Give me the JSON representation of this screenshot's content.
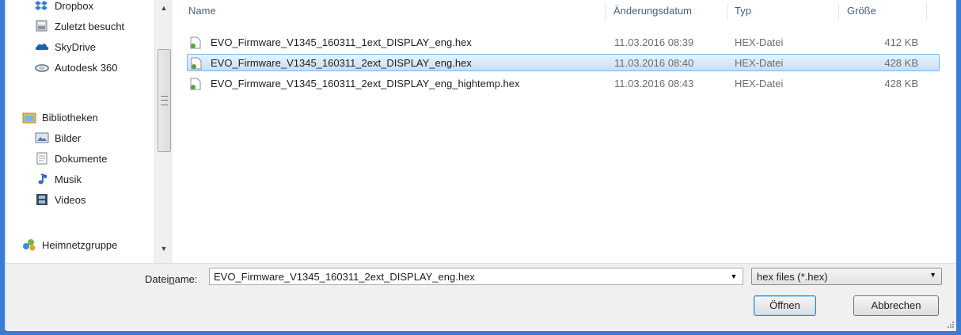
{
  "nav": {
    "items": [
      {
        "label": "Dropbox",
        "icon": "dropbox-icon"
      },
      {
        "label": "Zuletzt besucht",
        "icon": "recent-places-icon"
      },
      {
        "label": "SkyDrive",
        "icon": "skydrive-icon"
      },
      {
        "label": "Autodesk 360",
        "icon": "autodesk-360-icon"
      },
      {
        "label": "Bibliotheken",
        "icon": "libraries-icon"
      },
      {
        "label": "Bilder",
        "icon": "pictures-icon"
      },
      {
        "label": "Dokumente",
        "icon": "documents-icon"
      },
      {
        "label": "Musik",
        "icon": "music-icon"
      },
      {
        "label": "Videos",
        "icon": "videos-icon"
      },
      {
        "label": "Heimnetzgruppe",
        "icon": "homegroup-icon"
      }
    ]
  },
  "columns": {
    "name": "Name",
    "date": "Änderungsdatum",
    "type": "Typ",
    "size": "Größe"
  },
  "files": [
    {
      "name": "EVO_Firmware_V1345_160311_1ext_DISPLAY_eng.hex",
      "date": "11.03.2016 08:39",
      "type": "HEX-Datei",
      "size": "412 KB",
      "selected": false
    },
    {
      "name": "EVO_Firmware_V1345_160311_2ext_DISPLAY_eng.hex",
      "date": "11.03.2016 08:40",
      "type": "HEX-Datei",
      "size": "428 KB",
      "selected": true
    },
    {
      "name": "EVO_Firmware_V1345_160311_2ext_DISPLAY_eng_hightemp.hex",
      "date": "11.03.2016 08:43",
      "type": "HEX-Datei",
      "size": "428 KB",
      "selected": false
    }
  ],
  "bottom": {
    "filename_label_pre": "Datei",
    "filename_label_u": "n",
    "filename_label_post": "ame:",
    "filename_value": "EVO_Firmware_V1345_160311_2ext_DISPLAY_eng.hex",
    "filter_value": "hex files (*.hex)",
    "open_label": "Öffnen",
    "cancel_label": "Abbrechen"
  },
  "colors": {
    "frame": "#3a7bd5",
    "selection": "#c4e0fb",
    "header_text": "#4c607a"
  }
}
